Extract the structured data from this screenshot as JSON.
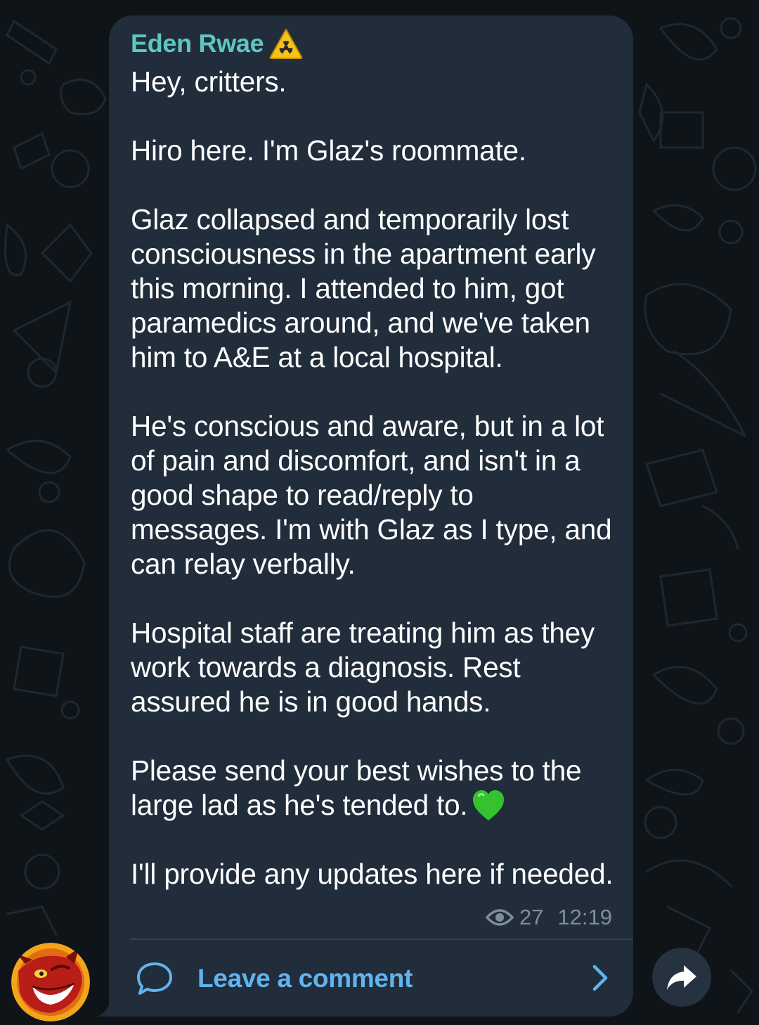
{
  "message": {
    "sender_name": "Eden Rwae",
    "sender_badge_icon": "radiation-warning-icon",
    "paragraphs": [
      "Hey, critters.",
      "Hiro here. I'm Glaz's roommate.",
      "Glaz collapsed and temporarily lost consciousness in the apartment early this morning. I attended to him, got paramedics around, and we've taken him to A&E at a local hospital.",
      "He's conscious and aware, but in a lot of pain and discomfort, and isn't in a good shape to read/reply to messages. I'm with Glaz as I type, and can relay verbally.",
      "Hospital staff are treating him as they work towards a diagnosis. Rest assured he is in good hands.",
      "Please send your best wishes to the large lad as he's tended to.",
      "I'll provide any updates here if needed."
    ],
    "heart_emoji": "green-heart-icon",
    "views": "27",
    "time": "12:19"
  },
  "comments": {
    "label": "Leave a comment"
  },
  "colors": {
    "background": "#0f1418",
    "bubble": "#212d3b",
    "sender_name": "#5fc7c1",
    "link_accent": "#61b3ee",
    "meta_text": "#7e8d9c"
  }
}
